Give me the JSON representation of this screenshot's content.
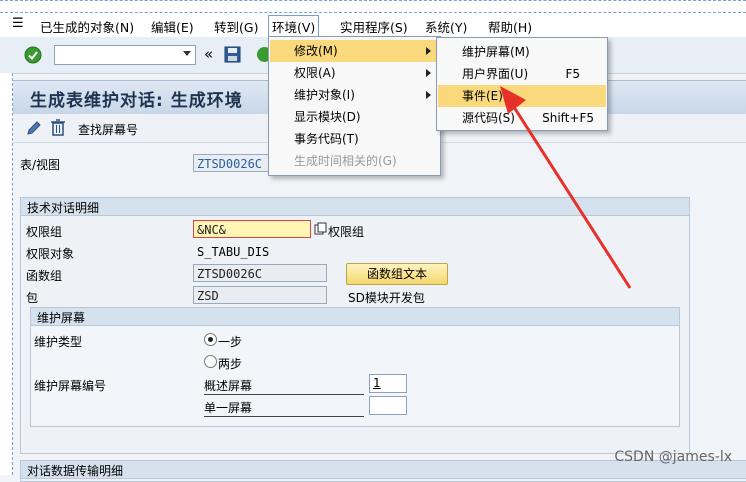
{
  "menubar": {
    "items": [
      "已生成的对象(N)",
      "编辑(E)",
      "转到(G)",
      "环境(V)",
      "实用程序(S)",
      "系统(Y)",
      "帮助(H)"
    ]
  },
  "toolbar": {
    "command_field_value": "",
    "nav_back_glyph": "«"
  },
  "title": "生成表维护对话: 生成环境",
  "app_toolbar": {
    "find_screen_label": "查找屏幕号"
  },
  "table_view": {
    "label": "表/视图",
    "value": "ZTSD0026C"
  },
  "tech_group": {
    "title": "技术对话明细",
    "auth_group_label": "权限组",
    "auth_group_value": "&NC&",
    "auth_group_side_label": "权限组",
    "auth_object_label": "权限对象",
    "auth_object_value": "S_TABU_DIS",
    "func_group_label": "函数组",
    "func_group_value": "ZTSD0026C",
    "func_group_button": "函数组文本",
    "package_label": "包",
    "package_value": "ZSD",
    "package_desc": "SD模块开发包"
  },
  "maint_group": {
    "title": "维护屏幕",
    "type_label": "维护类型",
    "options": [
      "一步",
      "两步"
    ],
    "selected": 0,
    "screen_no_label": "维护屏幕编号",
    "overview_label": "概述屏幕",
    "overview_value": "1",
    "single_label": "单一屏幕",
    "single_value": ""
  },
  "transfer_group": {
    "title": "对话数据传输明细"
  },
  "env_menu": {
    "items": [
      {
        "label": "修改(M)",
        "submenu": true,
        "highlight": true,
        "disabled": false
      },
      {
        "label": "权限(A)",
        "submenu": true,
        "highlight": false,
        "disabled": false
      },
      {
        "label": "维护对象(I)",
        "submenu": true,
        "highlight": false,
        "disabled": false
      },
      {
        "label": "显示模块(D)",
        "submenu": false,
        "highlight": false,
        "disabled": false
      },
      {
        "label": "事务代码(T)",
        "submenu": false,
        "highlight": false,
        "disabled": false
      },
      {
        "label": "生成时间相关的(G)",
        "submenu": false,
        "highlight": false,
        "disabled": true
      }
    ]
  },
  "modify_menu": {
    "items": [
      {
        "label": "维护屏幕(M)",
        "shortcut": "",
        "highlight": false
      },
      {
        "label": "用户界面(U)",
        "shortcut": "F5",
        "highlight": false
      },
      {
        "label": "事件(E)",
        "shortcut": "",
        "highlight": true
      },
      {
        "label": "源代码(S)",
        "shortcut": "Shift+F5",
        "highlight": false
      }
    ]
  },
  "watermark": "CSDN @james-lx",
  "colors": {
    "highlight": "#f9d97c",
    "arrow": "#e8302a",
    "title_text": "#1d3350",
    "field_blue": "#2960a6"
  }
}
